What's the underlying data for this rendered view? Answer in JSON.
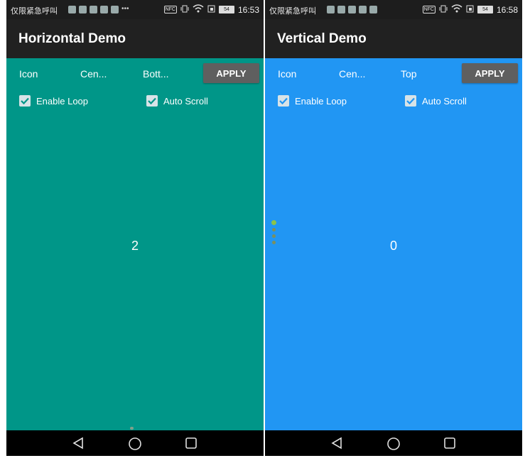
{
  "screens": [
    {
      "status_bar": {
        "carrier": "仅限紧急呼叫",
        "nfc": "NFC",
        "battery": "54",
        "time": "16:53"
      },
      "title": "Horizontal Demo",
      "controls": {
        "spinner1": "Icon",
        "spinner2": "Cen...",
        "spinner3": "Bott...",
        "apply": "APPLY",
        "enable_loop": "Enable Loop",
        "auto_scroll": "Auto Scroll"
      },
      "page_number": "2",
      "background": "#009688"
    },
    {
      "status_bar": {
        "carrier": "仅限紧急呼叫",
        "nfc": "NFC",
        "battery": "54",
        "time": "16:58"
      },
      "title": "Vertical Demo",
      "controls": {
        "spinner1": "Icon",
        "spinner2": "Cen...",
        "spinner3": "Top",
        "apply": "APPLY",
        "enable_loop": "Enable Loop",
        "auto_scroll": "Auto Scroll"
      },
      "page_number": "0",
      "background": "#2196f3"
    }
  ],
  "nav_bar": {
    "icons": [
      "back-icon",
      "home-icon",
      "recent-apps-icon"
    ]
  },
  "colors": {
    "app_bar": "#212121",
    "status_bar": "#1d1d1d",
    "apply_button": "#5f5f5f",
    "checkbox_check": "#009688"
  }
}
